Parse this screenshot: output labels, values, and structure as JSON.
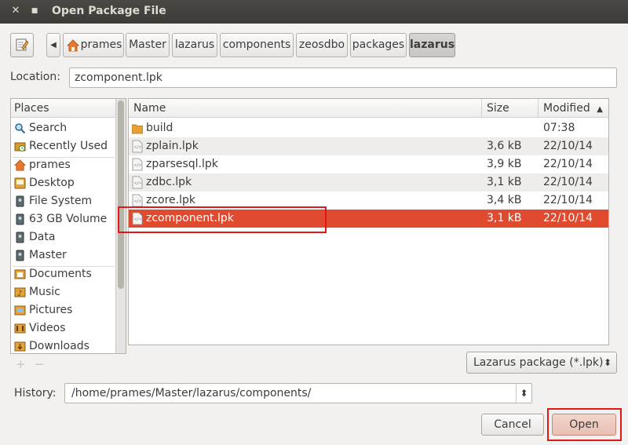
{
  "window": {
    "title": "Open Package File",
    "close_glyph": "✕",
    "min_glyph": "■"
  },
  "toolbar": {
    "edit_icon": "pencil-icon",
    "back_glyph": "◀",
    "crumbs": [
      "prames",
      "Master",
      "lazarus",
      "components",
      "zeosdbo",
      "packages",
      "lazarus"
    ]
  },
  "location": {
    "label": "Location:",
    "value": "zcomponent.lpk"
  },
  "places": {
    "header": "Places",
    "items": [
      {
        "label": "Search",
        "icon": "search-icon"
      },
      {
        "label": "Recently Used",
        "icon": "recent-icon"
      },
      {
        "label": "prames",
        "icon": "home-icon"
      },
      {
        "label": "Desktop",
        "icon": "desktop-icon"
      },
      {
        "label": "File System",
        "icon": "drive-icon"
      },
      {
        "label": "63 GB Volume",
        "icon": "drive-icon"
      },
      {
        "label": "Data",
        "icon": "drive-icon"
      },
      {
        "label": "Master",
        "icon": "drive-icon"
      },
      {
        "label": "Documents",
        "icon": "documents-icon"
      },
      {
        "label": "Music",
        "icon": "music-icon"
      },
      {
        "label": "Pictures",
        "icon": "pictures-icon"
      },
      {
        "label": "Videos",
        "icon": "videos-icon"
      },
      {
        "label": "Downloads",
        "icon": "downloads-icon"
      }
    ],
    "add_glyph": "+",
    "remove_glyph": "−"
  },
  "files": {
    "columns": {
      "name": "Name",
      "size": "Size",
      "modified": "Modified",
      "sort_glyph": "▲"
    },
    "rows": [
      {
        "name": "build",
        "size": "",
        "modified": "07:38",
        "type": "folder"
      },
      {
        "name": "zplain.lpk",
        "size": "3,6 kB",
        "modified": "22/10/14",
        "type": "file"
      },
      {
        "name": "zparsesql.lpk",
        "size": "3,9 kB",
        "modified": "22/10/14",
        "type": "file"
      },
      {
        "name": "zdbc.lpk",
        "size": "3,1 kB",
        "modified": "22/10/14",
        "type": "file"
      },
      {
        "name": "zcore.lpk",
        "size": "3,4 kB",
        "modified": "22/10/14",
        "type": "file"
      },
      {
        "name": "zcomponent.lpk",
        "size": "3,1 kB",
        "modified": "22/10/14",
        "type": "file",
        "selected": true
      }
    ]
  },
  "filter": {
    "value": "Lazarus package (*.lpk)",
    "glyph": "⬍"
  },
  "history": {
    "label": "History:",
    "value": "/home/prames/Master/lazarus/components/",
    "glyph": "⬍"
  },
  "buttons": {
    "cancel": "Cancel",
    "open": "Open"
  },
  "colors": {
    "selection": "#e04a2f",
    "highlight_box": "#e01818",
    "titlebar": "#3c3b37"
  }
}
